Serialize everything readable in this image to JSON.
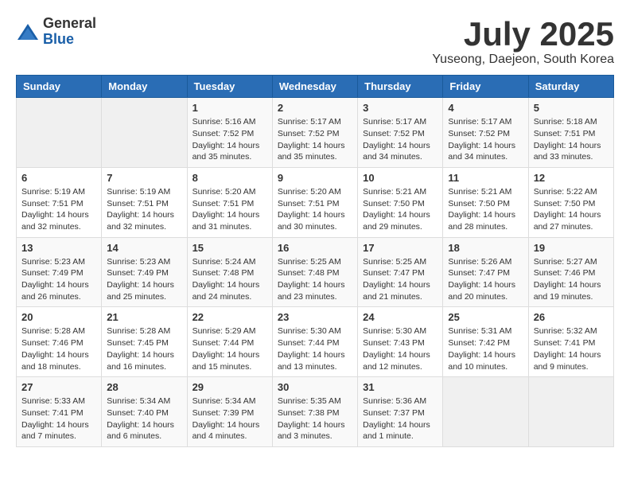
{
  "logo": {
    "general": "General",
    "blue": "Blue"
  },
  "title": "July 2025",
  "subtitle": "Yuseong, Daejeon, South Korea",
  "days_of_week": [
    "Sunday",
    "Monday",
    "Tuesday",
    "Wednesday",
    "Thursday",
    "Friday",
    "Saturday"
  ],
  "weeks": [
    [
      {
        "day": "",
        "info": ""
      },
      {
        "day": "",
        "info": ""
      },
      {
        "day": "1",
        "info": "Sunrise: 5:16 AM\nSunset: 7:52 PM\nDaylight: 14 hours and 35 minutes."
      },
      {
        "day": "2",
        "info": "Sunrise: 5:17 AM\nSunset: 7:52 PM\nDaylight: 14 hours and 35 minutes."
      },
      {
        "day": "3",
        "info": "Sunrise: 5:17 AM\nSunset: 7:52 PM\nDaylight: 14 hours and 34 minutes."
      },
      {
        "day": "4",
        "info": "Sunrise: 5:17 AM\nSunset: 7:52 PM\nDaylight: 14 hours and 34 minutes."
      },
      {
        "day": "5",
        "info": "Sunrise: 5:18 AM\nSunset: 7:51 PM\nDaylight: 14 hours and 33 minutes."
      }
    ],
    [
      {
        "day": "6",
        "info": "Sunrise: 5:19 AM\nSunset: 7:51 PM\nDaylight: 14 hours and 32 minutes."
      },
      {
        "day": "7",
        "info": "Sunrise: 5:19 AM\nSunset: 7:51 PM\nDaylight: 14 hours and 32 minutes."
      },
      {
        "day": "8",
        "info": "Sunrise: 5:20 AM\nSunset: 7:51 PM\nDaylight: 14 hours and 31 minutes."
      },
      {
        "day": "9",
        "info": "Sunrise: 5:20 AM\nSunset: 7:51 PM\nDaylight: 14 hours and 30 minutes."
      },
      {
        "day": "10",
        "info": "Sunrise: 5:21 AM\nSunset: 7:50 PM\nDaylight: 14 hours and 29 minutes."
      },
      {
        "day": "11",
        "info": "Sunrise: 5:21 AM\nSunset: 7:50 PM\nDaylight: 14 hours and 28 minutes."
      },
      {
        "day": "12",
        "info": "Sunrise: 5:22 AM\nSunset: 7:50 PM\nDaylight: 14 hours and 27 minutes."
      }
    ],
    [
      {
        "day": "13",
        "info": "Sunrise: 5:23 AM\nSunset: 7:49 PM\nDaylight: 14 hours and 26 minutes."
      },
      {
        "day": "14",
        "info": "Sunrise: 5:23 AM\nSunset: 7:49 PM\nDaylight: 14 hours and 25 minutes."
      },
      {
        "day": "15",
        "info": "Sunrise: 5:24 AM\nSunset: 7:48 PM\nDaylight: 14 hours and 24 minutes."
      },
      {
        "day": "16",
        "info": "Sunrise: 5:25 AM\nSunset: 7:48 PM\nDaylight: 14 hours and 23 minutes."
      },
      {
        "day": "17",
        "info": "Sunrise: 5:25 AM\nSunset: 7:47 PM\nDaylight: 14 hours and 21 minutes."
      },
      {
        "day": "18",
        "info": "Sunrise: 5:26 AM\nSunset: 7:47 PM\nDaylight: 14 hours and 20 minutes."
      },
      {
        "day": "19",
        "info": "Sunrise: 5:27 AM\nSunset: 7:46 PM\nDaylight: 14 hours and 19 minutes."
      }
    ],
    [
      {
        "day": "20",
        "info": "Sunrise: 5:28 AM\nSunset: 7:46 PM\nDaylight: 14 hours and 18 minutes."
      },
      {
        "day": "21",
        "info": "Sunrise: 5:28 AM\nSunset: 7:45 PM\nDaylight: 14 hours and 16 minutes."
      },
      {
        "day": "22",
        "info": "Sunrise: 5:29 AM\nSunset: 7:44 PM\nDaylight: 14 hours and 15 minutes."
      },
      {
        "day": "23",
        "info": "Sunrise: 5:30 AM\nSunset: 7:44 PM\nDaylight: 14 hours and 13 minutes."
      },
      {
        "day": "24",
        "info": "Sunrise: 5:30 AM\nSunset: 7:43 PM\nDaylight: 14 hours and 12 minutes."
      },
      {
        "day": "25",
        "info": "Sunrise: 5:31 AM\nSunset: 7:42 PM\nDaylight: 14 hours and 10 minutes."
      },
      {
        "day": "26",
        "info": "Sunrise: 5:32 AM\nSunset: 7:41 PM\nDaylight: 14 hours and 9 minutes."
      }
    ],
    [
      {
        "day": "27",
        "info": "Sunrise: 5:33 AM\nSunset: 7:41 PM\nDaylight: 14 hours and 7 minutes."
      },
      {
        "day": "28",
        "info": "Sunrise: 5:34 AM\nSunset: 7:40 PM\nDaylight: 14 hours and 6 minutes."
      },
      {
        "day": "29",
        "info": "Sunrise: 5:34 AM\nSunset: 7:39 PM\nDaylight: 14 hours and 4 minutes."
      },
      {
        "day": "30",
        "info": "Sunrise: 5:35 AM\nSunset: 7:38 PM\nDaylight: 14 hours and 3 minutes."
      },
      {
        "day": "31",
        "info": "Sunrise: 5:36 AM\nSunset: 7:37 PM\nDaylight: 14 hours and 1 minute."
      },
      {
        "day": "",
        "info": ""
      },
      {
        "day": "",
        "info": ""
      }
    ]
  ]
}
